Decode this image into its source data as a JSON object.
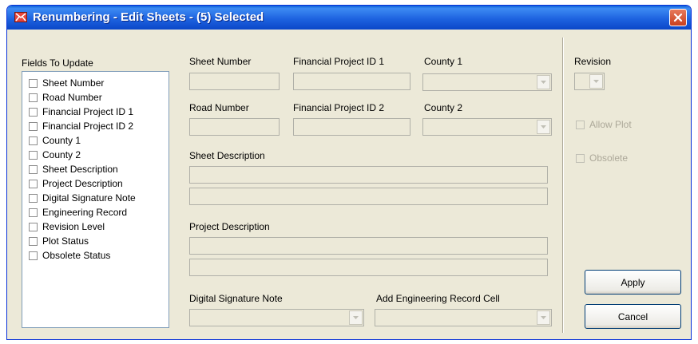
{
  "window": {
    "title": "Renumbering - Edit Sheets - (5) Selected"
  },
  "fields_panel": {
    "label": "Fields To Update",
    "items": [
      "Sheet Number",
      "Road Number",
      "Financial Project ID 1",
      "Financial Project ID 2",
      "County 1",
      "County 2",
      "Sheet Description",
      "Project Description",
      "Digital Signature Note",
      "Engineering Record",
      "Revision Level",
      "Plot Status",
      "Obsolete Status"
    ]
  },
  "form": {
    "sheet_number_label": "Sheet Number",
    "fin_project_id1_label": "Financial Project ID 1",
    "county1_label": "County 1",
    "road_number_label": "Road Number",
    "fin_project_id2_label": "Financial Project ID 2",
    "county2_label": "County 2",
    "sheet_description_label": "Sheet Description",
    "project_description_label": "Project Description",
    "digital_signature_label": "Digital Signature Note",
    "engineering_record_label": "Add Engineering Record Cell"
  },
  "side": {
    "revision_label": "Revision",
    "allow_plot_label": "Allow Plot",
    "obsolete_label": "Obsolete",
    "apply_label": "Apply",
    "cancel_label": "Cancel"
  },
  "icons": {
    "app": "app-icon",
    "close": "close-icon",
    "dropdown": "chevron-down-icon"
  },
  "colors": {
    "titlebar": "#0b47c8",
    "dialog_bg": "#ece9d8",
    "close_button": "#c8401e",
    "disabled_text": "#aca899"
  }
}
